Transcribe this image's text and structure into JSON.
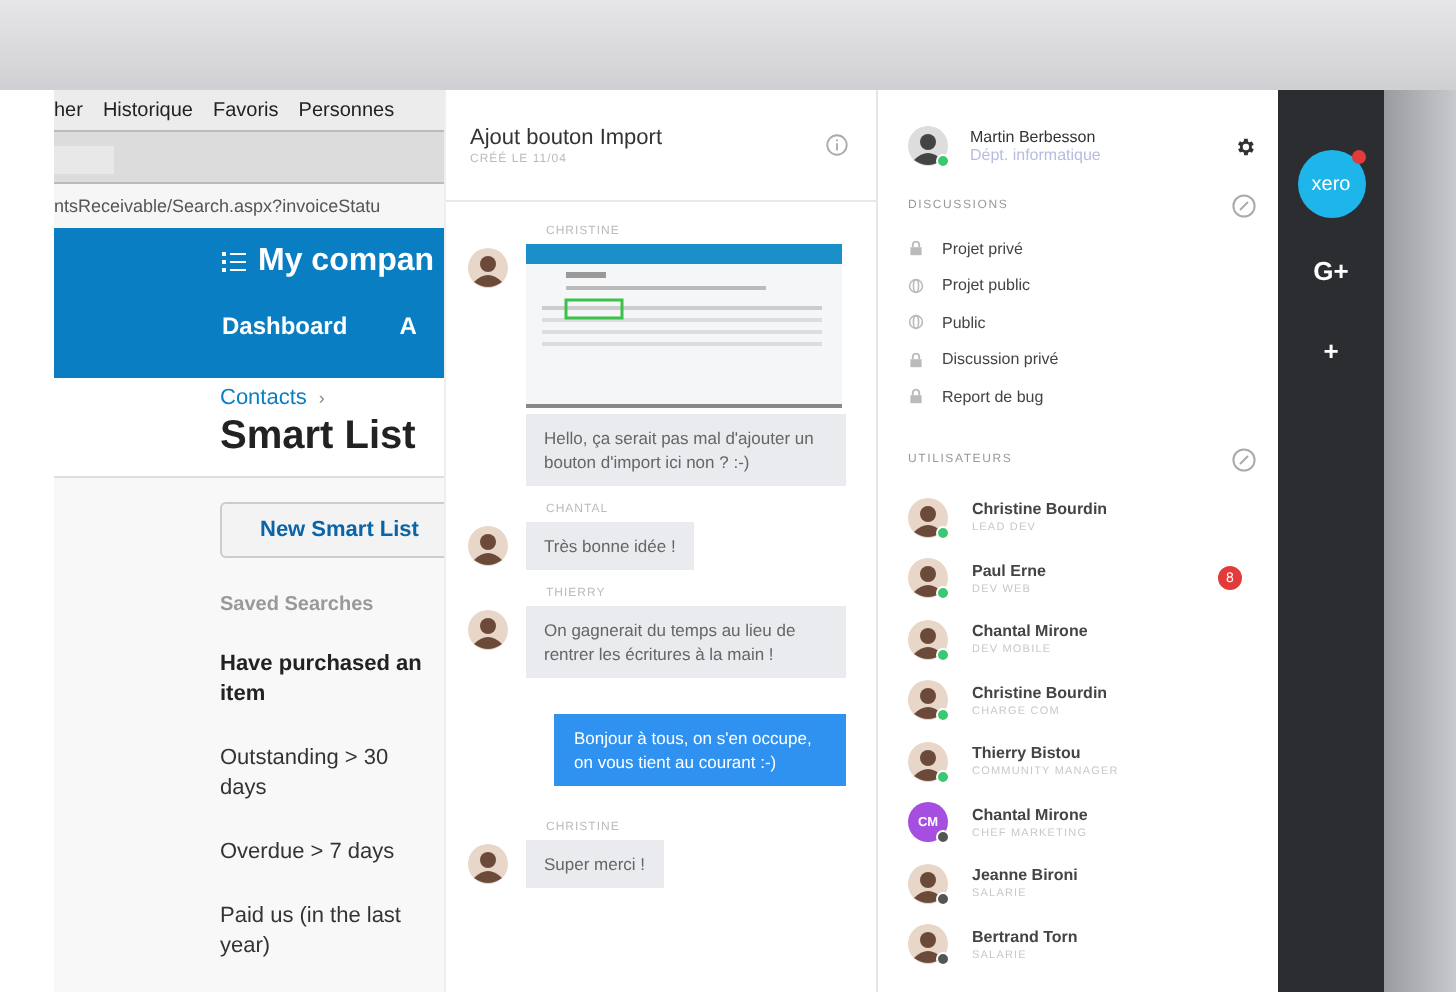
{
  "browser": {
    "menu": [
      "her",
      "Historique",
      "Favoris",
      "Personnes"
    ],
    "address": "ntsReceivable/Search.aspx?invoiceStatu",
    "app_title": "My compan",
    "nav": [
      "Dashboard",
      "A"
    ],
    "breadcrumb": "Contacts",
    "breadcrumb_sep": "›",
    "heading": "Smart List",
    "new_button": "New Smart List",
    "saved_title": "Saved Searches",
    "saved": [
      {
        "label": "Have purchased an item",
        "selected": true
      },
      {
        "label": "Outstanding > 30 days",
        "selected": false
      },
      {
        "label": "Overdue > 7 days",
        "selected": false
      },
      {
        "label": "Paid us (in the last year)",
        "selected": false
      }
    ]
  },
  "chat": {
    "title": "Ajout bouton Import",
    "subtitle": "CRÉÉ LE 11/04",
    "messages": [
      {
        "kind": "incoming",
        "author": "CHRISTINE",
        "attachment": true,
        "text": "Hello, ça serait pas mal d'ajouter un bouton d'import ici non ? :-)"
      },
      {
        "kind": "incoming",
        "author": "CHANTAL",
        "attachment": false,
        "text": "Très bonne idée !"
      },
      {
        "kind": "incoming",
        "author": "THIERRY",
        "attachment": false,
        "text": "On gagnerait du temps au lieu de rentrer les écritures à la main !"
      },
      {
        "kind": "outgoing",
        "text": "Bonjour à tous, on s'en occupe, on vous tient au courant :-)"
      },
      {
        "kind": "incoming",
        "author": "CHRISTINE",
        "attachment": false,
        "text": "Super merci !"
      }
    ]
  },
  "people": {
    "me": {
      "name": "Martin Berbesson",
      "role": "Dépt. informatique",
      "online": true
    },
    "discussions_title": "DISCUSSIONS",
    "discussions": [
      {
        "kind": "private",
        "label": "Projet privé"
      },
      {
        "kind": "public",
        "label": "Projet public"
      },
      {
        "kind": "public",
        "label": "Public"
      },
      {
        "kind": "private",
        "label": "Discussion privé"
      },
      {
        "kind": "private",
        "label": "Report de bug"
      }
    ],
    "users_title": "UTILISATEURS",
    "users": [
      {
        "kind": "photo",
        "name": "Christine Bourdin",
        "role": "LEAD DEV",
        "online": true
      },
      {
        "kind": "photo",
        "name": "Paul Erne",
        "role": "DEV WEB",
        "online": true,
        "badge": "8"
      },
      {
        "kind": "photo",
        "name": "Chantal Mirone",
        "role": "DEV MOBILE",
        "online": true
      },
      {
        "kind": "photo",
        "name": "Christine Bourdin",
        "role": "CHARGE COM",
        "online": true
      },
      {
        "kind": "photo",
        "name": "Thierry Bistou",
        "role": "COMMUNITY MANAGER",
        "online": true
      },
      {
        "kind": "initials",
        "initials": "CM",
        "name": "Chantal Mirone",
        "role": "CHEF MARKETING",
        "online": false
      },
      {
        "kind": "photo",
        "name": "Jeanne Bironi",
        "role": "SALARIE",
        "online": false
      },
      {
        "kind": "photo",
        "name": "Bertrand Torn",
        "role": "SALARIE",
        "online": false
      }
    ]
  },
  "dock": [
    {
      "kind": "app",
      "label": "xero",
      "notify": true
    },
    {
      "kind": "plain",
      "label": "G+"
    },
    {
      "kind": "plain",
      "label": "+"
    }
  ]
}
